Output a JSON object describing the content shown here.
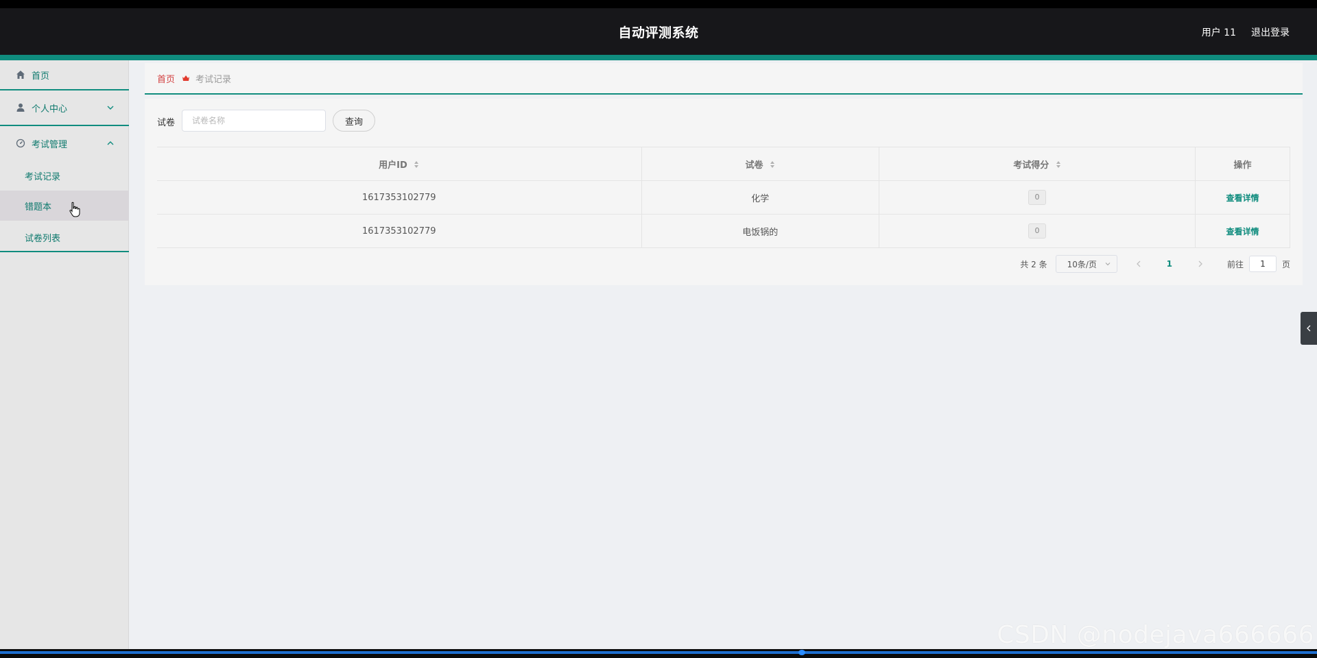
{
  "header": {
    "title": "自动评测系统",
    "user": "用户 11",
    "logout": "退出登录"
  },
  "sidebar": {
    "home": "首页",
    "personal_center": "个人中心",
    "exam_management": "考试管理",
    "submenu": [
      "考试记录",
      "错题本",
      "试卷列表"
    ],
    "active_submenu": "错题本"
  },
  "breadcrumb": {
    "home": "首页",
    "current": "考试记录"
  },
  "search": {
    "label": "试卷",
    "placeholder": "试卷名称",
    "value": "",
    "button": "查询"
  },
  "table": {
    "columns": [
      "用户ID",
      "试卷",
      "考试得分",
      "操作"
    ],
    "rows": [
      {
        "user_id": "1617353102779",
        "paper": "化学",
        "score": "0",
        "action": "查看详情"
      },
      {
        "user_id": "1617353102779",
        "paper": "电饭锅的",
        "score": "0",
        "action": "查看详情"
      }
    ]
  },
  "pagination": {
    "total": "共 2 条",
    "page_size": "10条/页",
    "current_page": "1",
    "goto_label": "前往",
    "goto_value": "1",
    "page_suffix": "页"
  },
  "watermark": "CSDN @nodejava666666",
  "colors": {
    "accent": "#0f8c7e",
    "header_bg": "#17171a",
    "breadcrumb_home": "#d23e3e"
  }
}
